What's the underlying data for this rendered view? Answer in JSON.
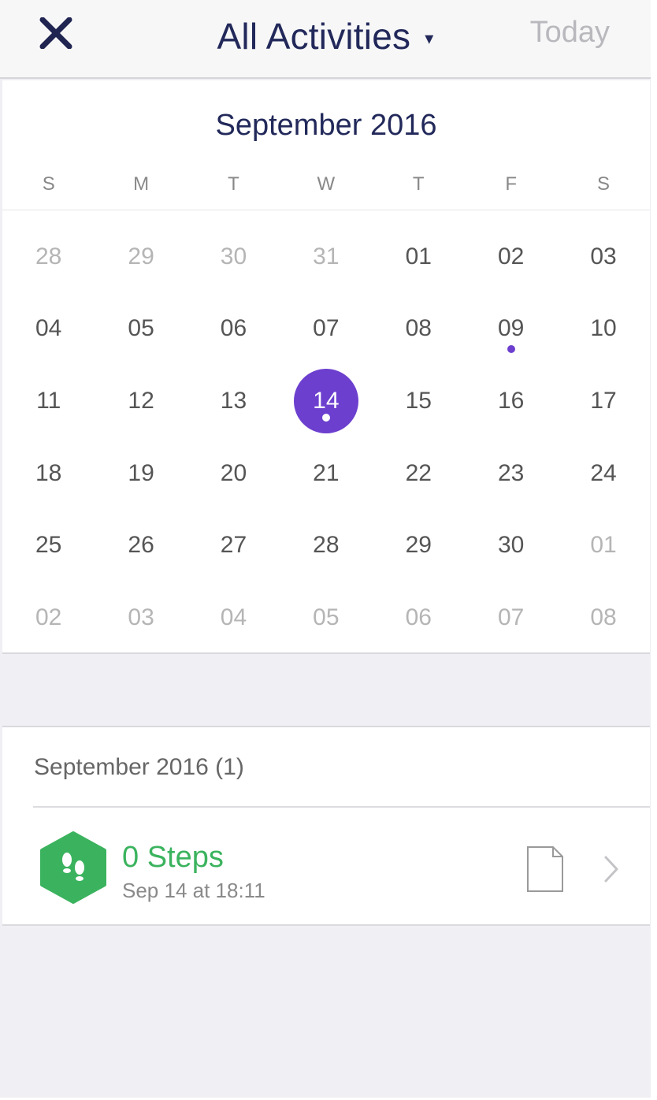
{
  "header": {
    "title": "All Activities",
    "caret": "▾",
    "today_label": "Today",
    "close_icon": "close-icon"
  },
  "calendar": {
    "month_title": "September 2016",
    "weekdays": [
      "S",
      "M",
      "T",
      "W",
      "T",
      "F",
      "S"
    ],
    "days": [
      {
        "label": "28",
        "muted": true
      },
      {
        "label": "29",
        "muted": true
      },
      {
        "label": "30",
        "muted": true
      },
      {
        "label": "31",
        "muted": true
      },
      {
        "label": "01"
      },
      {
        "label": "02"
      },
      {
        "label": "03"
      },
      {
        "label": "04"
      },
      {
        "label": "05"
      },
      {
        "label": "06"
      },
      {
        "label": "07"
      },
      {
        "label": "08"
      },
      {
        "label": "09",
        "has_activity": true
      },
      {
        "label": "10"
      },
      {
        "label": "11"
      },
      {
        "label": "12"
      },
      {
        "label": "13"
      },
      {
        "label": "14",
        "selected": true,
        "has_activity": true
      },
      {
        "label": "15"
      },
      {
        "label": "16"
      },
      {
        "label": "17"
      },
      {
        "label": "18"
      },
      {
        "label": "19"
      },
      {
        "label": "20"
      },
      {
        "label": "21"
      },
      {
        "label": "22"
      },
      {
        "label": "23"
      },
      {
        "label": "24"
      },
      {
        "label": "25"
      },
      {
        "label": "26"
      },
      {
        "label": "27"
      },
      {
        "label": "28"
      },
      {
        "label": "29"
      },
      {
        "label": "30"
      },
      {
        "label": "01",
        "muted": true
      },
      {
        "label": "02",
        "muted": true
      },
      {
        "label": "03",
        "muted": true
      },
      {
        "label": "04",
        "muted": true
      },
      {
        "label": "05",
        "muted": true
      },
      {
        "label": "06",
        "muted": true
      },
      {
        "label": "07",
        "muted": true
      },
      {
        "label": "08",
        "muted": true
      }
    ],
    "accent_color": "#6c3fce"
  },
  "activities": {
    "section_title": "September 2016 (1)",
    "items": [
      {
        "title": "0 Steps",
        "subtitle": "Sep 14 at 18:11",
        "icon": "steps-hexagon-icon",
        "color": "#3bb35e",
        "doc_icon": "document-icon",
        "chevron_icon": "chevron-right-icon"
      }
    ]
  }
}
